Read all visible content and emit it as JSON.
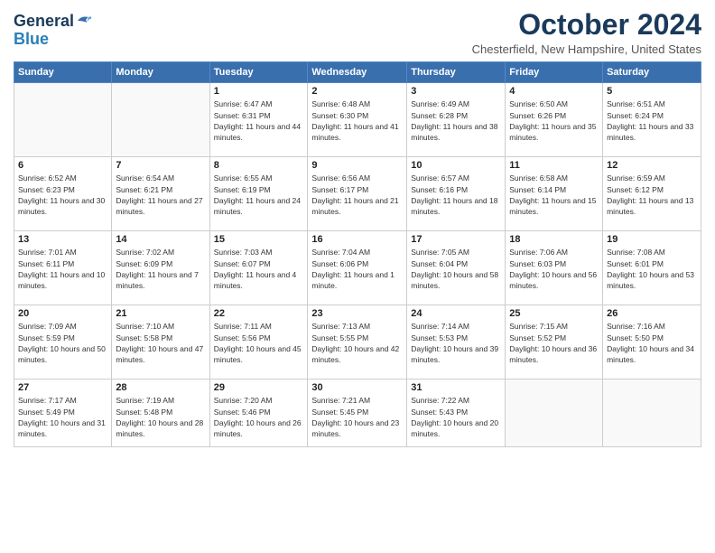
{
  "header": {
    "logo_line1": "General",
    "logo_line2": "Blue",
    "month_title": "October 2024",
    "location": "Chesterfield, New Hampshire, United States"
  },
  "weekdays": [
    "Sunday",
    "Monday",
    "Tuesday",
    "Wednesday",
    "Thursday",
    "Friday",
    "Saturday"
  ],
  "weeks": [
    [
      {
        "day": "",
        "info": ""
      },
      {
        "day": "",
        "info": ""
      },
      {
        "day": "1",
        "info": "Sunrise: 6:47 AM\nSunset: 6:31 PM\nDaylight: 11 hours and 44 minutes."
      },
      {
        "day": "2",
        "info": "Sunrise: 6:48 AM\nSunset: 6:30 PM\nDaylight: 11 hours and 41 minutes."
      },
      {
        "day": "3",
        "info": "Sunrise: 6:49 AM\nSunset: 6:28 PM\nDaylight: 11 hours and 38 minutes."
      },
      {
        "day": "4",
        "info": "Sunrise: 6:50 AM\nSunset: 6:26 PM\nDaylight: 11 hours and 35 minutes."
      },
      {
        "day": "5",
        "info": "Sunrise: 6:51 AM\nSunset: 6:24 PM\nDaylight: 11 hours and 33 minutes."
      }
    ],
    [
      {
        "day": "6",
        "info": "Sunrise: 6:52 AM\nSunset: 6:23 PM\nDaylight: 11 hours and 30 minutes."
      },
      {
        "day": "7",
        "info": "Sunrise: 6:54 AM\nSunset: 6:21 PM\nDaylight: 11 hours and 27 minutes."
      },
      {
        "day": "8",
        "info": "Sunrise: 6:55 AM\nSunset: 6:19 PM\nDaylight: 11 hours and 24 minutes."
      },
      {
        "day": "9",
        "info": "Sunrise: 6:56 AM\nSunset: 6:17 PM\nDaylight: 11 hours and 21 minutes."
      },
      {
        "day": "10",
        "info": "Sunrise: 6:57 AM\nSunset: 6:16 PM\nDaylight: 11 hours and 18 minutes."
      },
      {
        "day": "11",
        "info": "Sunrise: 6:58 AM\nSunset: 6:14 PM\nDaylight: 11 hours and 15 minutes."
      },
      {
        "day": "12",
        "info": "Sunrise: 6:59 AM\nSunset: 6:12 PM\nDaylight: 11 hours and 13 minutes."
      }
    ],
    [
      {
        "day": "13",
        "info": "Sunrise: 7:01 AM\nSunset: 6:11 PM\nDaylight: 11 hours and 10 minutes."
      },
      {
        "day": "14",
        "info": "Sunrise: 7:02 AM\nSunset: 6:09 PM\nDaylight: 11 hours and 7 minutes."
      },
      {
        "day": "15",
        "info": "Sunrise: 7:03 AM\nSunset: 6:07 PM\nDaylight: 11 hours and 4 minutes."
      },
      {
        "day": "16",
        "info": "Sunrise: 7:04 AM\nSunset: 6:06 PM\nDaylight: 11 hours and 1 minute."
      },
      {
        "day": "17",
        "info": "Sunrise: 7:05 AM\nSunset: 6:04 PM\nDaylight: 10 hours and 58 minutes."
      },
      {
        "day": "18",
        "info": "Sunrise: 7:06 AM\nSunset: 6:03 PM\nDaylight: 10 hours and 56 minutes."
      },
      {
        "day": "19",
        "info": "Sunrise: 7:08 AM\nSunset: 6:01 PM\nDaylight: 10 hours and 53 minutes."
      }
    ],
    [
      {
        "day": "20",
        "info": "Sunrise: 7:09 AM\nSunset: 5:59 PM\nDaylight: 10 hours and 50 minutes."
      },
      {
        "day": "21",
        "info": "Sunrise: 7:10 AM\nSunset: 5:58 PM\nDaylight: 10 hours and 47 minutes."
      },
      {
        "day": "22",
        "info": "Sunrise: 7:11 AM\nSunset: 5:56 PM\nDaylight: 10 hours and 45 minutes."
      },
      {
        "day": "23",
        "info": "Sunrise: 7:13 AM\nSunset: 5:55 PM\nDaylight: 10 hours and 42 minutes."
      },
      {
        "day": "24",
        "info": "Sunrise: 7:14 AM\nSunset: 5:53 PM\nDaylight: 10 hours and 39 minutes."
      },
      {
        "day": "25",
        "info": "Sunrise: 7:15 AM\nSunset: 5:52 PM\nDaylight: 10 hours and 36 minutes."
      },
      {
        "day": "26",
        "info": "Sunrise: 7:16 AM\nSunset: 5:50 PM\nDaylight: 10 hours and 34 minutes."
      }
    ],
    [
      {
        "day": "27",
        "info": "Sunrise: 7:17 AM\nSunset: 5:49 PM\nDaylight: 10 hours and 31 minutes."
      },
      {
        "day": "28",
        "info": "Sunrise: 7:19 AM\nSunset: 5:48 PM\nDaylight: 10 hours and 28 minutes."
      },
      {
        "day": "29",
        "info": "Sunrise: 7:20 AM\nSunset: 5:46 PM\nDaylight: 10 hours and 26 minutes."
      },
      {
        "day": "30",
        "info": "Sunrise: 7:21 AM\nSunset: 5:45 PM\nDaylight: 10 hours and 23 minutes."
      },
      {
        "day": "31",
        "info": "Sunrise: 7:22 AM\nSunset: 5:43 PM\nDaylight: 10 hours and 20 minutes."
      },
      {
        "day": "",
        "info": ""
      },
      {
        "day": "",
        "info": ""
      }
    ]
  ]
}
